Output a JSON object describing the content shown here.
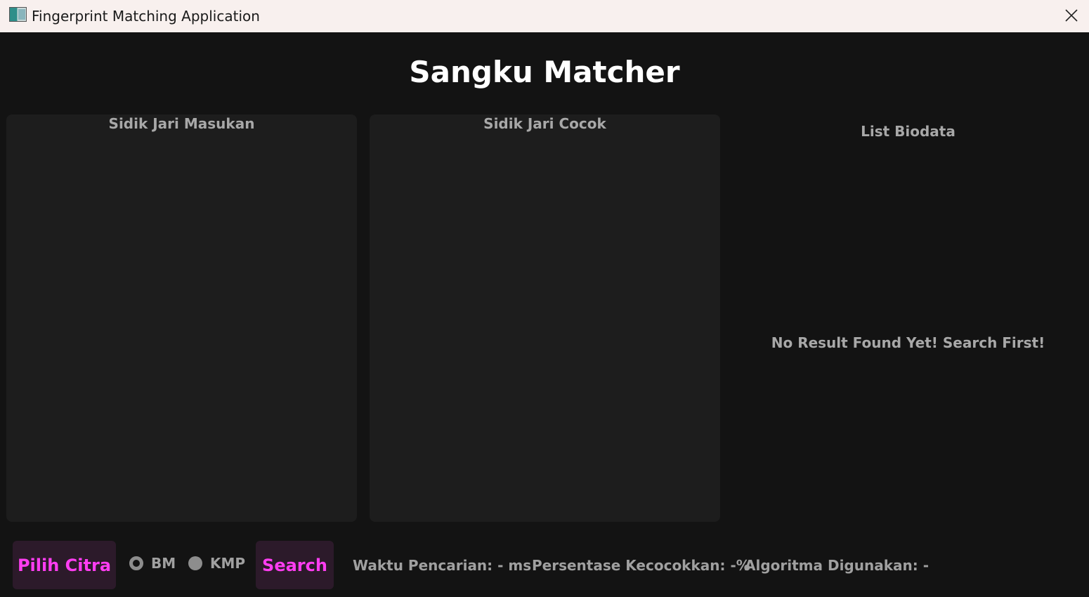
{
  "window": {
    "title": "Fingerprint Matching Application",
    "icon": "app-icon",
    "close_icon": "close-icon"
  },
  "header": {
    "title": "Sangku Matcher"
  },
  "panels": {
    "input": {
      "title": "Sidik Jari Masukan"
    },
    "match": {
      "title": "Sidik Jari Cocok"
    }
  },
  "biodata": {
    "title": "List Biodata",
    "empty_message": "No Result Found Yet! Search First!"
  },
  "controls": {
    "pick_label": "Pilih Citra",
    "search_label": "Search",
    "algorithms": [
      {
        "label": "BM",
        "selected": false
      },
      {
        "label": "KMP",
        "selected": false
      }
    ]
  },
  "stats": {
    "time": "Waktu Pencarian: - ms",
    "percentage": "Persentase Kecocokkan: -%",
    "algorithm": "Algoritma Digunakan: -"
  },
  "colors": {
    "background": "#131313",
    "panel": "#1d1d1d",
    "button_bg": "#2c1a2a",
    "accent": "#ff3df2",
    "muted_text": "#a8a8a8"
  }
}
